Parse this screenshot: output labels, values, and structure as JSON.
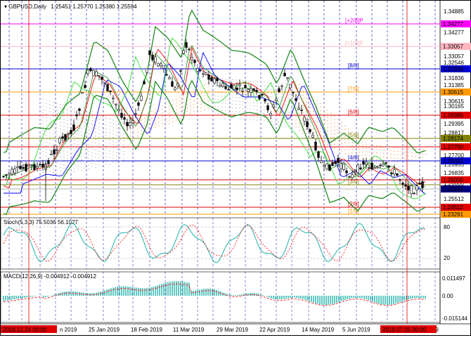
{
  "header": {
    "symbol_label": "GBPUSD,Daily",
    "ohlc": "1.25451 1.25770 1.25380 1.25594"
  },
  "indicators": {
    "stoch": {
      "label": "Stoch(5,3,3) 75.5036 56.1027",
      "levels": [
        "80",
        "20"
      ]
    },
    "macd": {
      "label": "MACD(12,26,9) -0.004912 -0.004912",
      "levels": [
        "0.011497",
        "0.00",
        "-0.015144"
      ]
    }
  },
  "colors": {
    "price_badge": "#000080",
    "level_red": "#e00000",
    "level_blue": "#0000cc",
    "level_orange": "#ff9900",
    "level_magenta": "#ff00ff",
    "level_olive": "#808000",
    "bollinger": "#228b22",
    "ma_red": "#ff0000",
    "ma_blue": "#0000ff",
    "ma_lime": "#33dd33",
    "stoch_main": "#20b2aa",
    "stoch_signal": "#ff0000",
    "macd_hist": "#20b2aa"
  },
  "price_axis": {
    "ticks": [
      "1.34885",
      "1.34277",
      "1.33057",
      "1.32546",
      "1.31836",
      "1.31385",
      "1.30615",
      "1.30165",
      "1.29395",
      "1.28817",
      "1.27700",
      "1.26953",
      "1.26835",
      "1.26000",
      "1.25594",
      "1.25512",
      "1.24512",
      "1.24304",
      "1.23291"
    ],
    "badges": [
      {
        "value": "1.34277",
        "color": "#ff00ff"
      },
      {
        "value": "1.33057",
        "color": "#ffb6c1"
      },
      {
        "value": "1.31836",
        "color": "#0000cc"
      },
      {
        "value": "1.30615",
        "color": "#ff9900"
      },
      {
        "value": "1.29395",
        "color": "#e00000"
      },
      {
        "value": "1.28174",
        "color": "#808000"
      },
      {
        "value": "1.27700",
        "color": "#e00000"
      },
      {
        "value": "1.26953",
        "color": "#0000cc"
      },
      {
        "value": "1.26000",
        "color": "#e00000"
      },
      {
        "value": "1.25594",
        "color": "#000080"
      },
      {
        "value": "1.24512",
        "color": "#e00000"
      },
      {
        "value": "1.23291",
        "color": "#ff9900"
      }
    ]
  },
  "murrey_levels": [
    {
      "label": "[+2/8]P",
      "color": "#ff00ff"
    },
    {
      "label": "[+1/8]P",
      "color": "#ffb6c1"
    },
    {
      "label": "[8/8]",
      "color": "#0000cc"
    },
    {
      "label": "[7/8]",
      "color": "#ff9900"
    },
    {
      "label": "[6/8]",
      "color": "#e00000"
    },
    {
      "label": "[5/8]",
      "color": "#808000"
    },
    {
      "label": "[4/8]",
      "color": "#0000cc"
    },
    {
      "label": "[3/8]",
      "color": "#808000"
    },
    {
      "label": "[2/8]",
      "color": "#e00000"
    },
    {
      "label": "[1/8]",
      "color": "#ff9900"
    }
  ],
  "time_axis": {
    "start_badge": "2018.12.24 00:00",
    "end_badge": "2019.07.05 00:00",
    "labels": [
      "n 2019",
      "25 Jan 2019",
      "18 Feb 2019",
      "11 Mar 2019",
      "29 Mar 2019",
      "22 Apr 2019",
      "14 May 2019",
      "5 Jun 2019",
      "2019"
    ]
  }
}
